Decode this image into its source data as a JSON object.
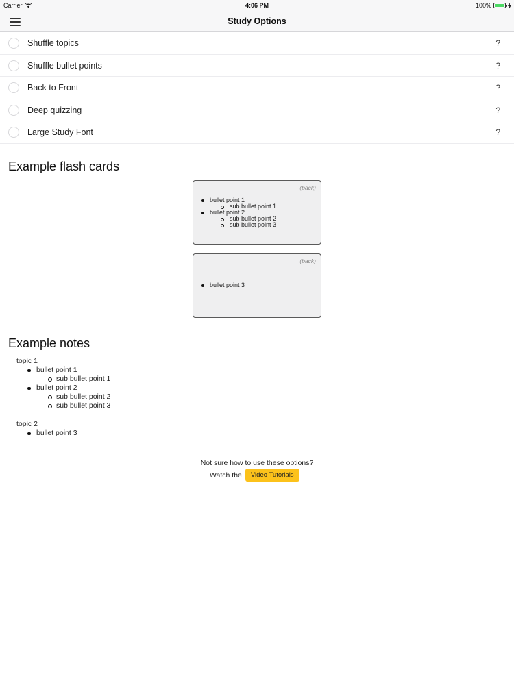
{
  "status_bar": {
    "carrier": "Carrier",
    "time": "4:06 PM",
    "battery": "100%",
    "icons": [
      "wifi-icon",
      "battery-icon",
      "charging-icon"
    ]
  },
  "nav": {
    "title": "Study Options",
    "menu_icon": "hamburger-icon"
  },
  "options": [
    {
      "label": "Shuffle topics",
      "help": "?"
    },
    {
      "label": "Shuffle bullet points",
      "help": "?"
    },
    {
      "label": "Back to Front",
      "help": "?"
    },
    {
      "label": "Deep quizzing",
      "help": "?"
    },
    {
      "label": "Large Study Font",
      "help": "?"
    }
  ],
  "flash_cards": {
    "heading": "Example flash cards",
    "cards": [
      {
        "tag": "(back)",
        "items": [
          {
            "text": "bullet point 1"
          },
          {
            "text": "sub bullet point 1"
          },
          {
            "text": "bullet point 2"
          },
          {
            "text": "sub bullet point 2"
          },
          {
            "text": "sub bullet point 3"
          }
        ]
      },
      {
        "tag": "(back)",
        "items": [
          {
            "text": "bullet point 3"
          }
        ]
      }
    ]
  },
  "notes": {
    "heading": "Example notes",
    "topic1": "topic 1",
    "t1_b1": "bullet point 1",
    "t1_s1": "sub bullet point 1",
    "t1_b2": "bullet point 2",
    "t1_s2": "sub bullet point 2",
    "t1_s3": "sub bullet point 3",
    "topic2": "topic 2",
    "t2_b1": "bullet point 3"
  },
  "help": {
    "question": "Not sure how to use these options?",
    "prefix": "Watch the",
    "button": "Video Tutorials"
  },
  "colors": {
    "accent": "#fcc21b",
    "battery": "#4cd964",
    "card_bg": "#efeff0"
  }
}
